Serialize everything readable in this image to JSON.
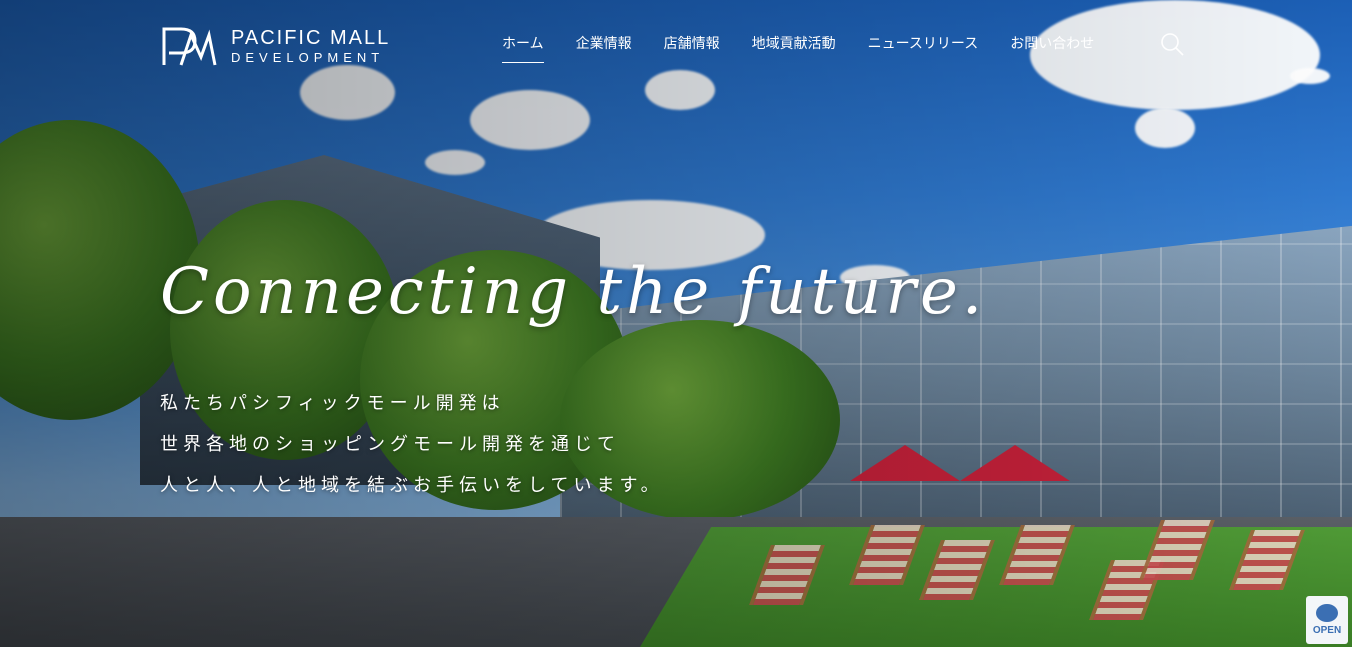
{
  "brand": {
    "line1": "PACIFIC MALL",
    "line2": "DEVELOPMENT",
    "mark_icon": "pm-logo-icon"
  },
  "nav": {
    "items": [
      {
        "label": "ホーム",
        "active": true
      },
      {
        "label": "企業情報"
      },
      {
        "label": "店舗情報"
      },
      {
        "label": "地域貢献活動"
      },
      {
        "label": "ニュースリリース"
      },
      {
        "label": "お問い合わせ"
      }
    ],
    "search_icon": "search-icon"
  },
  "hero": {
    "headline": "Connecting the future.",
    "tagline": [
      "私たちパシフィックモール開発は",
      "世界各地のショッピングモール開発を通じて",
      "人と人、人と地域を結ぶお手伝いをしています。"
    ]
  },
  "badge": {
    "label": "OPEN"
  },
  "colors": {
    "nav_text": "#ffffff",
    "accent_red": "#c6213a"
  }
}
